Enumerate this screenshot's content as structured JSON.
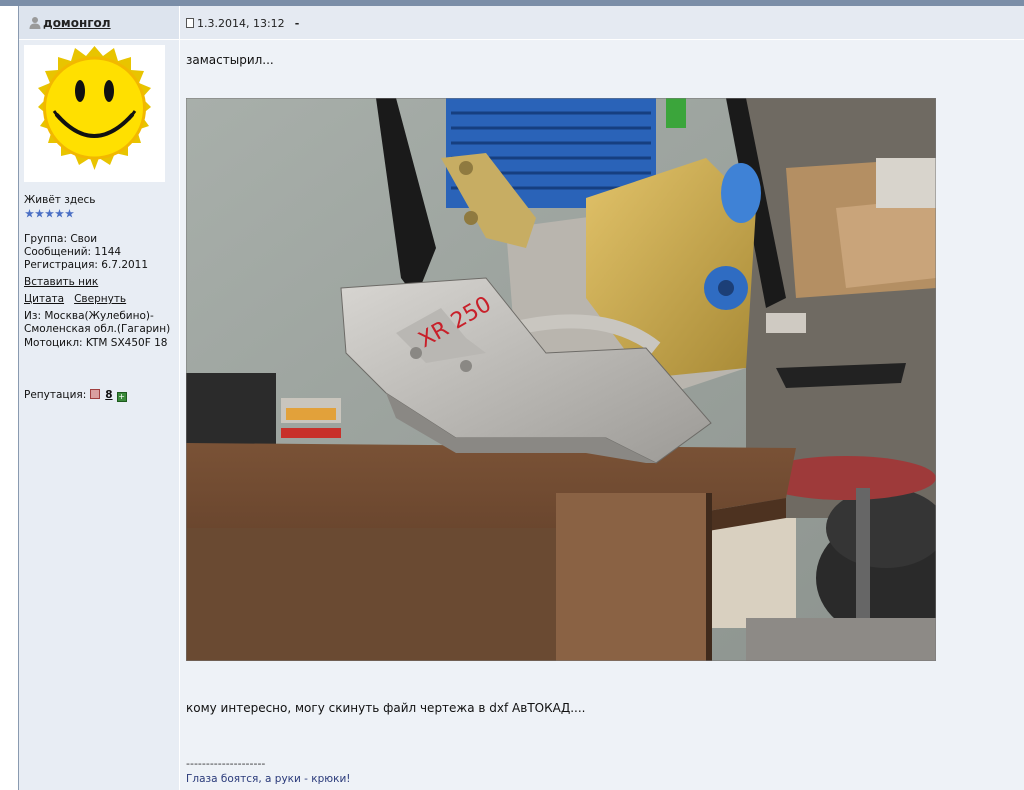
{
  "post": {
    "username": "домонгол",
    "date": "1.3.2014, 13:12",
    "header_dash": "-",
    "profile": {
      "status": "Живёт здесь",
      "rank_stars": 5,
      "group": "Группа: Свои",
      "posts": "Сообщений: 1144",
      "registered": "Регистрация: 6.7.2011",
      "insert_nick": "Вставить ник",
      "quote": "Цитата",
      "collapse": "Свернуть",
      "from_line1": "Из: Москва(Жулебино)-",
      "from_line2": "Смоленская обл.(Гагарин)",
      "bike": "Мотоцикл: KTM SX450F 18",
      "reputation_label": "Репутация:",
      "reputation_value": "8"
    },
    "message": {
      "line1": "замастырил...",
      "photo_caption": "XR 250",
      "line2": "кому интересно, могу скинуть файл чертежа в dxf АвТОКАД....",
      "signature_sep": "--------------------",
      "signature": "Глаза боятся, а руки - крюки!"
    }
  },
  "colors": {
    "header_bg": "#dde4ee",
    "body_bg": "#eef2f7",
    "signature": "#2a3a7a"
  }
}
